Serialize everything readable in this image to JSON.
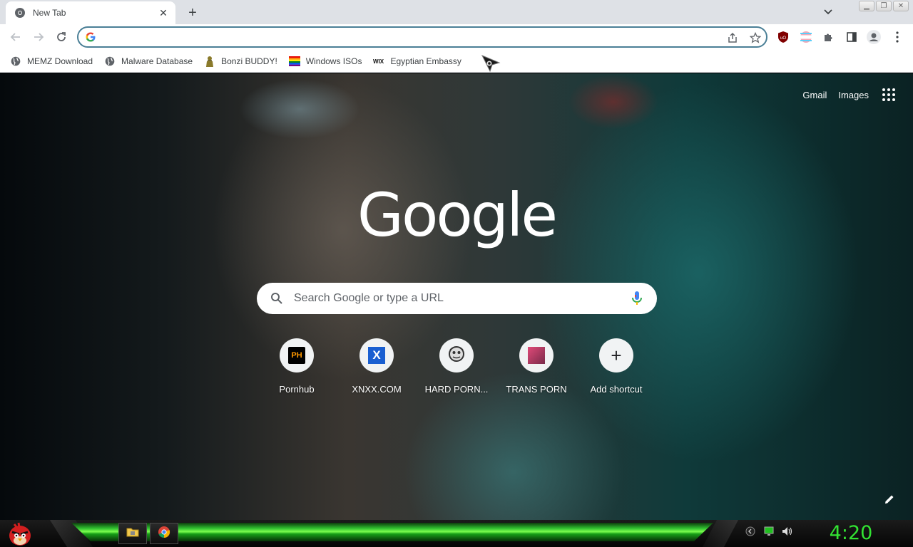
{
  "browser": {
    "tab": {
      "title": "New Tab"
    },
    "omnibox": {
      "value": "",
      "placeholder": ""
    },
    "bookmarks": [
      {
        "label": "MEMZ Download",
        "icon": "globe-icon"
      },
      {
        "label": "Malware Database",
        "icon": "globe-icon"
      },
      {
        "label": "Bonzi BUDDY!",
        "icon": "bonzi-icon"
      },
      {
        "label": "Windows ISOs",
        "icon": "rainbow-flag-icon"
      },
      {
        "label": "Egyptian Embassy",
        "icon": "wix-icon"
      }
    ]
  },
  "ntp": {
    "links": {
      "gmail": "Gmail",
      "images": "Images"
    },
    "logo": "Google",
    "search_placeholder": "Search Google or type a URL",
    "shortcuts": [
      {
        "label": "Pornhub",
        "icon_text": "PH"
      },
      {
        "label": "XNXX.COM",
        "icon_text": "X"
      },
      {
        "label": "HARD PORN...",
        "icon_text": ""
      },
      {
        "label": "TRANS PORN",
        "icon_text": ""
      },
      {
        "label": "Add shortcut",
        "icon_text": "+"
      }
    ]
  },
  "taskbar": {
    "clock": "4:20 AM",
    "accent_color": "#32e332"
  }
}
